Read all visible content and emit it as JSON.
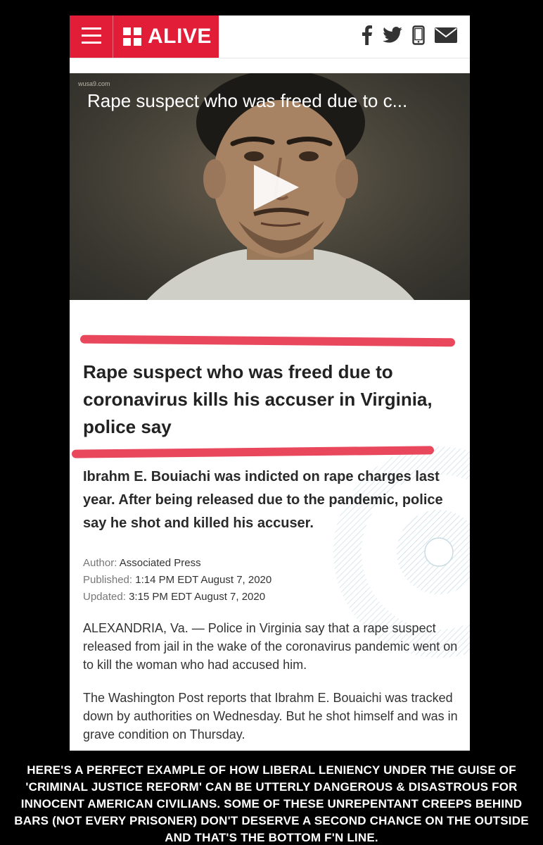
{
  "header": {
    "logo_text": "ALIVE",
    "social_icons": [
      "facebook-icon",
      "twitter-icon",
      "mobile-icon",
      "mail-icon"
    ],
    "brand_color": "#e21d38"
  },
  "video": {
    "source": "wusa9.com",
    "title": "Rape suspect who was freed due to c..."
  },
  "article": {
    "headline": "Rape suspect who was freed due to coronavirus kills his accuser in Virginia, police say",
    "summary": "Ibrahm E. Bouiachi was indicted on rape charges last year. After being released due to the pandemic, police say he shot and killed his accuser.",
    "author_label": "Author:",
    "author": "Associated Press",
    "published_label": "Published:",
    "published": "1:14 PM EDT August 7, 2020",
    "updated_label": "Updated:",
    "updated": "3:15 PM EDT August 7, 2020",
    "paragraphs": [
      "ALEXANDRIA, Va. — Police in Virginia say that a rape suspect released from jail in the wake of the coronavirus pandemic went on to kill the woman who had accused him.",
      "The Washington Post reports that Ibrahm E. Bouaichi was tracked down by authorities on Wednesday. But he shot himself and was in grave condition on Thursday."
    ],
    "highlight_color": "#e8475c"
  },
  "caption": "HERE'S A PERFECT EXAMPLE OF HOW LIBERAL LENIENCY UNDER THE GUISE OF 'CRIMINAL JUSTICE REFORM' CAN BE UTTERLY DANGEROUS & DISASTROUS FOR INNOCENT AMERICAN CIVILIANS. SOME OF THESE UNREPENTANT CREEPS BEHIND BARS (NOT EVERY PRISONER) DON'T DESERVE A SECOND CHANCE ON THE OUTSIDE AND THAT'S THE BOTTOM F'N LINE."
}
